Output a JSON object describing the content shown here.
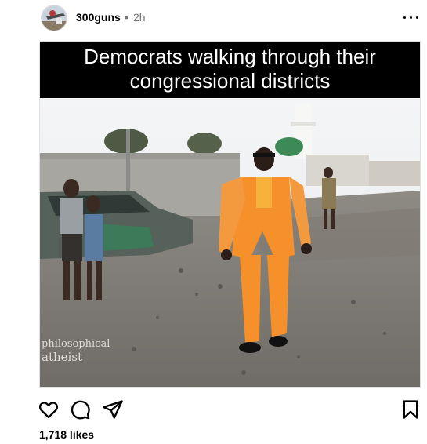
{
  "post": {
    "username": "300guns",
    "separator": "•",
    "time": "2h",
    "image_caption_line1": "Democrats walking through their",
    "image_caption_line2": "congressional districts",
    "watermark_line1": "philosophical",
    "watermark_line2": "atheist",
    "likes": "1,718 likes"
  },
  "icons": {
    "more": "more-options-icon",
    "like": "heart-icon",
    "comment": "comment-icon",
    "share": "send-icon",
    "save": "bookmark-icon"
  },
  "colors": {
    "text": "#000000",
    "muted": "#737373",
    "suit": "#f5902a"
  }
}
